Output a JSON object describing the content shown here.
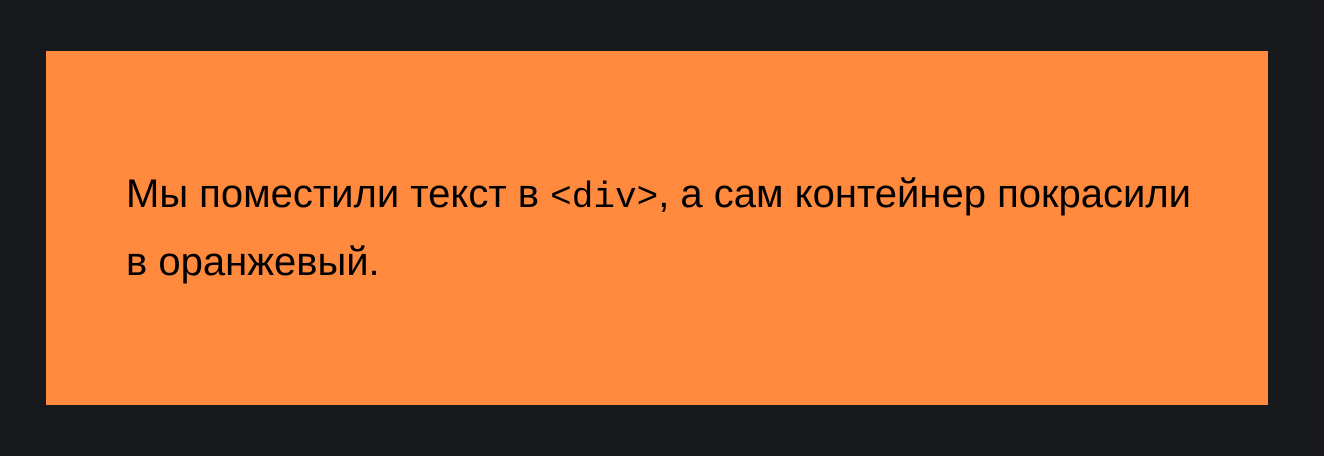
{
  "colors": {
    "page_background": "#18191c",
    "box_background": "#ff8a3d",
    "text": "#000000"
  },
  "content": {
    "text_before_code": "Мы поместили текст в ",
    "code": "<div>",
    "text_after_code": ", а сам контейнер покрасили в оранжевый."
  }
}
